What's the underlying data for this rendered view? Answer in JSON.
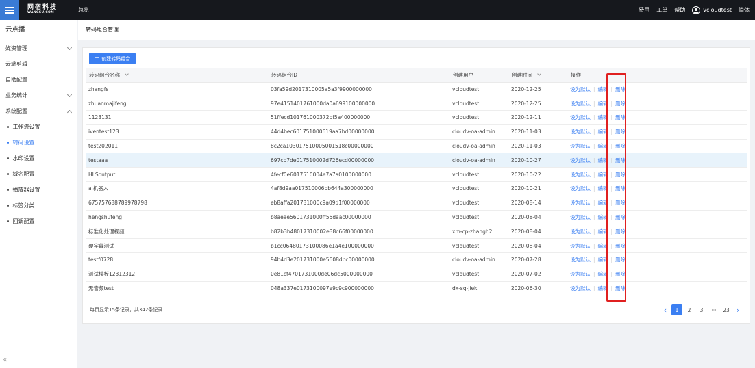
{
  "topbar": {
    "logo_cn": "网宿科技",
    "logo_en": "WANGSU.COM",
    "nav_overview": "总览",
    "links": [
      "费用",
      "工单",
      "帮助"
    ],
    "username": "vcloudtest",
    "lang": "简体"
  },
  "sidebar": {
    "title": "云点播",
    "items": [
      {
        "label": "媒资管理",
        "chevron": "down"
      },
      {
        "label": "云端剪辑",
        "chevron": ""
      },
      {
        "label": "自助配置",
        "chevron": ""
      },
      {
        "label": "业务统计",
        "chevron": "down"
      },
      {
        "label": "系统配置",
        "chevron": "up"
      }
    ],
    "subitems": [
      {
        "label": "工作流设置",
        "active": false
      },
      {
        "label": "转码设置",
        "active": true
      },
      {
        "label": "水印设置",
        "active": false
      },
      {
        "label": "域名配置",
        "active": false
      },
      {
        "label": "播放器设置",
        "active": false
      },
      {
        "label": "标签分类",
        "active": false
      },
      {
        "label": "回调配置",
        "active": false
      }
    ],
    "collapse_icon": "«"
  },
  "page": {
    "title": "转码组合管理",
    "create_label": "创建转码组合",
    "create_plus": "+"
  },
  "table": {
    "headers": {
      "name": "转码组合名称",
      "id": "转码组合ID",
      "user": "创建用户",
      "time": "创建时间",
      "ops": "操作"
    },
    "op_default": "设为默认",
    "op_edit": "编辑",
    "op_delete": "删除",
    "op_sep": "|",
    "rows": [
      {
        "name": "zhangfs",
        "id": "03fa59d2017310005a5a3f9900000000",
        "user": "vcloudtest",
        "time": "2020-12-25"
      },
      {
        "name": "zhuanmajifeng",
        "id": "97e4151401761000da0a699100000000",
        "user": "vcloudtest",
        "time": "2020-12-25"
      },
      {
        "name": "1123131",
        "id": "51ffecd101761000372bf5a400000000",
        "user": "vcloudtest",
        "time": "2020-12-11"
      },
      {
        "name": "iventest123",
        "id": "44d4bec601751000619aa7bd00000000",
        "user": "cloudv-oa-admin",
        "time": "2020-11-03"
      },
      {
        "name": "test202011",
        "id": "8c2ca103017510005001518c00000000",
        "user": "cloudv-oa-admin",
        "time": "2020-11-03"
      },
      {
        "name": "testaaa",
        "id": "697cb7de017510002d726ecd00000000",
        "user": "cloudv-oa-admin",
        "time": "2020-10-27"
      },
      {
        "name": "HLSoutput",
        "id": "4fecf0e6017510004e7a7a0100000000",
        "user": "vcloudtest",
        "time": "2020-10-22"
      },
      {
        "name": "ai机器人",
        "id": "4af8d9aa017510006bb644a300000000",
        "user": "vcloudtest",
        "time": "2020-10-21"
      },
      {
        "name": "675757688789978798",
        "id": "eb8affa201731000c9a09d1f00000000",
        "user": "vcloudtest",
        "time": "2020-08-14"
      },
      {
        "name": "hengshufeng",
        "id": "b8aeae5601731000ff55daac00000000",
        "user": "vcloudtest",
        "time": "2020-08-04"
      },
      {
        "name": "标准化处理视频",
        "id": "b82b3b48017310002e38c66f00000000",
        "user": "xm-cp-zhangh2",
        "time": "2020-08-04"
      },
      {
        "name": "硬字幕测试",
        "id": "b1cc06480173100086e1a4e100000000",
        "user": "vcloudtest",
        "time": "2020-08-04"
      },
      {
        "name": "testf0728",
        "id": "94b4d3e201731000e5608dbc00000000",
        "user": "cloudv-oa-admin",
        "time": "2020-07-28"
      },
      {
        "name": "测试模板12312312",
        "id": "0e81cf4701731000de06dc5000000000",
        "user": "vcloudtest",
        "time": "2020-07-02"
      },
      {
        "name": "无音频test",
        "id": "048a337e0173100097e9c9c900000000",
        "user": "dx-sq-jiek",
        "time": "2020-06-30"
      }
    ],
    "highlight_index": 5
  },
  "footer": {
    "summary": "每页显示15条记录，共342条记录"
  },
  "pagination": {
    "prev": "‹",
    "next": "›",
    "pages": [
      "1",
      "2",
      "3",
      "···",
      "23"
    ],
    "active": "1"
  },
  "colors": {
    "accent": "#3b7ff2",
    "topbar": "#16181d",
    "highlight_box": "#e02020"
  }
}
